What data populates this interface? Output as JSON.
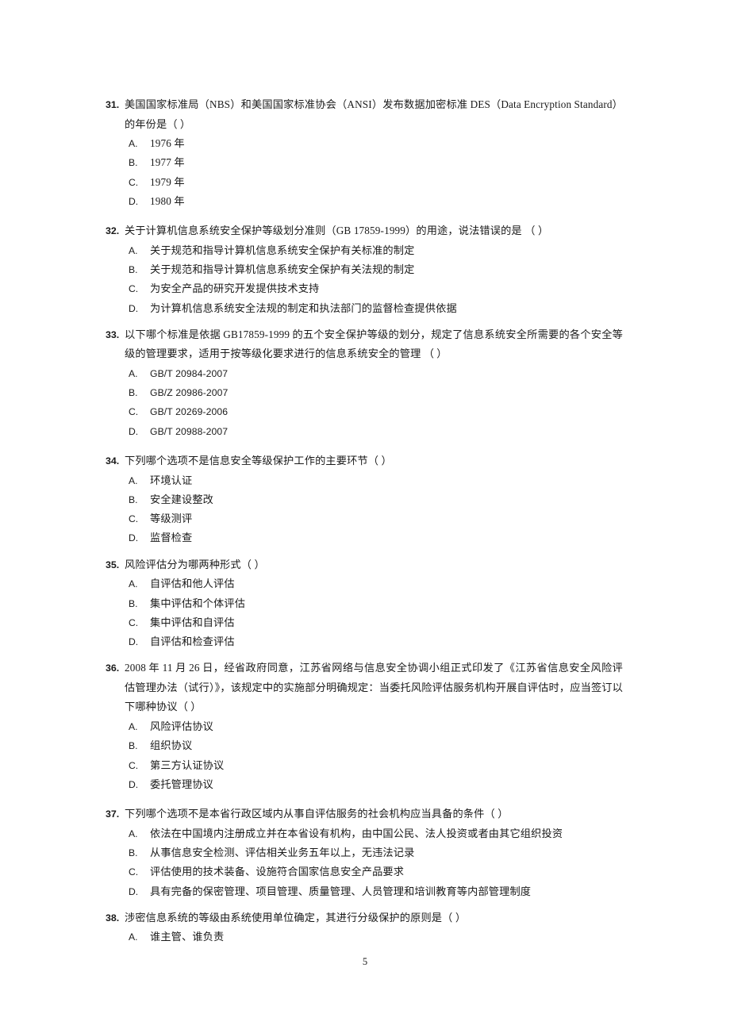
{
  "document": {
    "page_number": "5"
  },
  "questions": [
    {
      "number": "31.",
      "text_lines": [
        "美国国家标准局（NBS）和美国国家标准协会（ANSI）发布数据加密标准 DES（Data Encryption",
        "Standard）的年份是（      ）"
      ],
      "text": "美国国家标准局（NBS）和美国国家标准协会（ANSI）发布数据加密标准 DES（Data Encryption Standard）的年份是（      ）",
      "options": [
        {
          "letter": "A.",
          "text": "1976 年"
        },
        {
          "letter": "B.",
          "text": "1977 年"
        },
        {
          "letter": "C.",
          "text": "1979 年"
        },
        {
          "letter": "D.",
          "text": "1980 年"
        }
      ]
    },
    {
      "number": "32.",
      "text": "关于计算机信息系统安全保护等级划分准则（GB 17859-1999）的用途，说法错误的是  （      ）",
      "options": [
        {
          "letter": "A.",
          "text": "关于规范和指导计算机信息系统安全保护有关标准的制定"
        },
        {
          "letter": "B.",
          "text": "关于规范和指导计算机信息系统安全保护有关法规的制定"
        },
        {
          "letter": "C.",
          "text": "为安全产品的研究开发提供技术支持"
        },
        {
          "letter": "D.",
          "text": "为计算机信息系统安全法规的制定和执法部门的监督检查提供依据"
        }
      ]
    },
    {
      "number": "33.",
      "text_lines": [
        "以下哪个标准是依据 GB17859-1999 的五个安全保护等级的划分，规定了信息系统安全所需要的各个安",
        "全等级的管理要求，适用于按等级化要求进行的信息系统安全的管理  （      ）"
      ],
      "text": "以下哪个标准是依据 GB17859-1999 的五个安全保护等级的划分，规定了信息系统安全所需要的各个安全等级的管理要求，适用于按等级化要求进行的信息系统安全的管理  （      ）",
      "options": [
        {
          "letter": "A.",
          "text": "GB/T 20984-2007"
        },
        {
          "letter": "B.",
          "text": "GB/Z 20986-2007"
        },
        {
          "letter": "C.",
          "text": "GB/T 20269-2006"
        },
        {
          "letter": "D.",
          "text": "GB/T 20988-2007"
        }
      ]
    },
    {
      "number": "34.",
      "text": "下列哪个选项不是信息安全等级保护工作的主要环节（      ）",
      "options": [
        {
          "letter": "A.",
          "text": "环境认证"
        },
        {
          "letter": "B.",
          "text": "安全建设整改"
        },
        {
          "letter": "C.",
          "text": "等级测评"
        },
        {
          "letter": "D.",
          "text": "监督检查"
        }
      ]
    },
    {
      "number": "35.",
      "text": "风险评估分为哪两种形式（      ）",
      "options": [
        {
          "letter": "A.",
          "text": "自评估和他人评估"
        },
        {
          "letter": "B.",
          "text": "集中评估和个体评估"
        },
        {
          "letter": "C.",
          "text": "集中评估和自评估"
        },
        {
          "letter": "D.",
          "text": "自评估和检查评估"
        }
      ]
    },
    {
      "number": "36.",
      "text_lines": [
        "2008 年 11 月 26 日，经省政府同意，江苏省网络与信息安全协调小组正式印发了《江苏省信息安全风",
        "险评估管理办法（试行）》，该规定中的实施部分明确规定：当委托风险评估服务机构开展自评估时，",
        "应当签订以下哪种协议（      ）"
      ],
      "text": "2008 年 11 月 26 日，经省政府同意，江苏省网络与信息安全协调小组正式印发了《江苏省信息安全风险评估管理办法（试行）》，该规定中的实施部分明确规定：当委托风险评估服务机构开展自评估时，应当签订以下哪种协议（      ）",
      "options": [
        {
          "letter": "A.",
          "text": "风险评估协议"
        },
        {
          "letter": "B.",
          "text": "组织协议"
        },
        {
          "letter": "C.",
          "text": "第三方认证协议"
        },
        {
          "letter": "D.",
          "text": "委托管理协议"
        }
      ]
    },
    {
      "number": "37.",
      "text": "下列哪个选项不是本省行政区域内从事自评估服务的社会机构应当具备的条件（      ）",
      "options": [
        {
          "letter": "A.",
          "text": "依法在中国境内注册成立并在本省设有机构，由中国公民、法人投资或者由其它组织投资"
        },
        {
          "letter": "B.",
          "text": "从事信息安全检测、评估相关业务五年以上，无违法记录"
        },
        {
          "letter": "C.",
          "text": "评估使用的技术装备、设施符合国家信息安全产品要求"
        },
        {
          "letter": "D.",
          "text": "具有完备的保密管理、项目管理、质量管理、人员管理和培训教育等内部管理制度"
        }
      ]
    },
    {
      "number": "38.",
      "text": "涉密信息系统的等级由系统使用单位确定，其进行分级保护的原则是（      ）",
      "options": [
        {
          "letter": "A.",
          "text": "谁主管、谁负责"
        }
      ]
    }
  ]
}
